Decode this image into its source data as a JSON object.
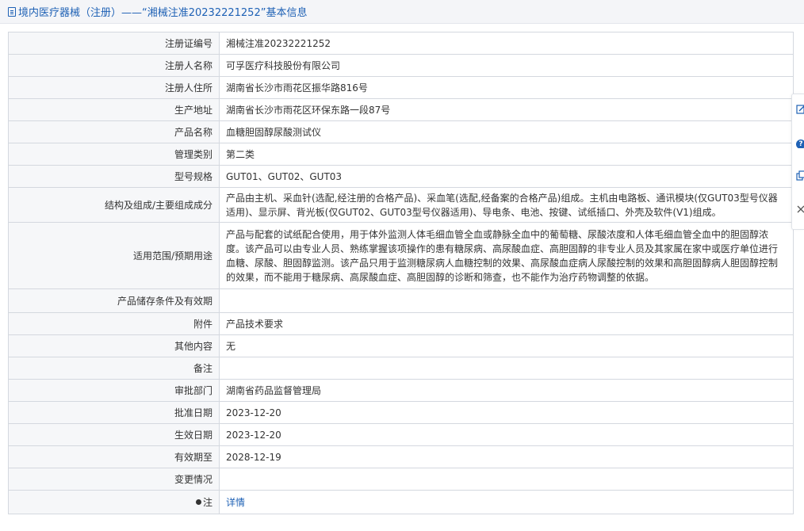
{
  "header": {
    "title": "境内医疗器械（注册）——“湘械注准20232221252”基本信息"
  },
  "rows": [
    {
      "label": "注册证编号",
      "value": "湘械注准20232221252"
    },
    {
      "label": "注册人名称",
      "value": "可孚医疗科技股份有限公司"
    },
    {
      "label": "注册人住所",
      "value": "湖南省长沙市雨花区振华路816号"
    },
    {
      "label": "生产地址",
      "value": "湖南省长沙市雨花区环保东路一段87号"
    },
    {
      "label": "产品名称",
      "value": "血糖胆固醇尿酸测试仪"
    },
    {
      "label": "管理类别",
      "value": "第二类"
    },
    {
      "label": "型号规格",
      "value": "GUT01、GUT02、GUT03"
    },
    {
      "label": "结构及组成/主要组成成分",
      "value": "产品由主机、采血针(选配,经注册的合格产品)、采血笔(选配,经备案的合格产品)组成。主机由电路板、通讯模块(仅GUT03型号仪器适用)、显示屏、背光板(仅GUT02、GUT03型号仪器适用)、导电条、电池、按键、试纸插口、外壳及软件(V1)组成。"
    },
    {
      "label": "适用范围/预期用途",
      "value": "产品与配套的试纸配合使用，用于体外监测人体毛细血管全血或静脉全血中的葡萄糖、尿酸浓度和人体毛细血管全血中的胆固醇浓度。该产品可以由专业人员、熟练掌握该项操作的患有糖尿病、高尿酸血症、高胆固醇的非专业人员及其家属在家中或医疗单位进行血糖、尿酸、胆固醇监测。该产品只用于监测糖尿病人血糖控制的效果、高尿酸血症病人尿酸控制的效果和高胆固醇病人胆固醇控制的效果，而不能用于糖尿病、高尿酸血症、高胆固醇的诊断和筛查，也不能作为治疗药物调整的依据。"
    },
    {
      "label": "产品储存条件及有效期",
      "value": ""
    },
    {
      "label": "附件",
      "value": "产品技术要求"
    },
    {
      "label": "其他内容",
      "value": "无"
    },
    {
      "label": "备注",
      "value": ""
    },
    {
      "label": "审批部门",
      "value": "湖南省药品监督管理局"
    },
    {
      "label": "批准日期",
      "value": "2023-12-20"
    },
    {
      "label": "生效日期",
      "value": "2023-12-20"
    },
    {
      "label": "有效期至",
      "value": "2028-12-19"
    },
    {
      "label": "变更情况",
      "value": ""
    },
    {
      "label": "注",
      "value": "详情"
    }
  ],
  "side_toolbar": {
    "icons": [
      "edit-icon",
      "help-icon",
      "copy-icon",
      "close-icon"
    ]
  },
  "colors": {
    "link": "#1e61b5",
    "label_bg": "#f6f7f9",
    "border": "#d4d8df",
    "header_bg": "#f4f5f8"
  }
}
